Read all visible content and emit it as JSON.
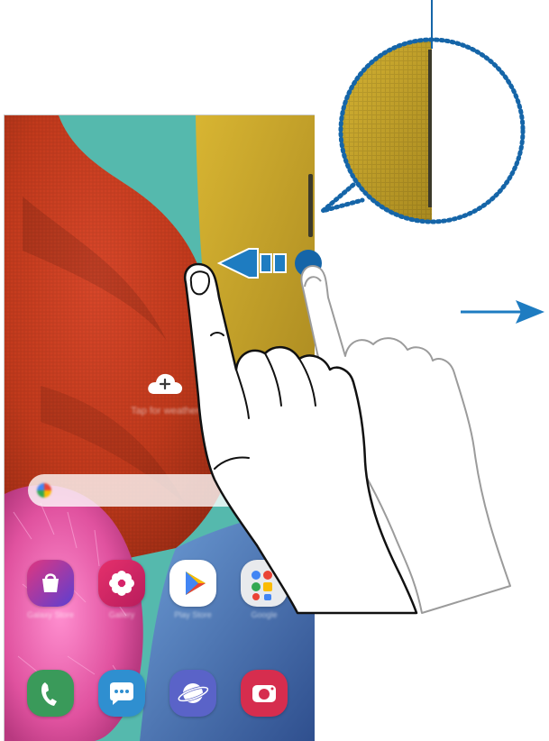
{
  "home_screen": {
    "weather_text": "Tap for weather",
    "apps_row": [
      {
        "name": "Galaxy Store",
        "icon": "shopping-bag-icon",
        "color": "#5a3ec8"
      },
      {
        "name": "Gallery",
        "icon": "flower-icon",
        "color": "#d6246a"
      },
      {
        "name": "Play Store",
        "icon": "play-store-icon",
        "color": "#ffffff"
      },
      {
        "name": "Google",
        "icon": "google-folder-icon",
        "color": "#e8eaed"
      }
    ],
    "dock": [
      {
        "name": "Phone",
        "icon": "phone-icon",
        "color": "#3a9a5a"
      },
      {
        "name": "Messages",
        "icon": "chat-bubble-icon",
        "color": "#2f8fd0"
      },
      {
        "name": "Internet",
        "icon": "planet-icon",
        "color": "#5a63c8"
      },
      {
        "name": "Camera",
        "icon": "camera-icon",
        "color": "#d62d4e"
      }
    ]
  },
  "colors": {
    "arrow_blue": "#1e7cc1",
    "highlight_blue": "#1565a8",
    "wallpaper_red": "#c83a1e",
    "wallpaper_teal": "#55b9ad",
    "wallpaper_yellow": "#c9a52a"
  }
}
